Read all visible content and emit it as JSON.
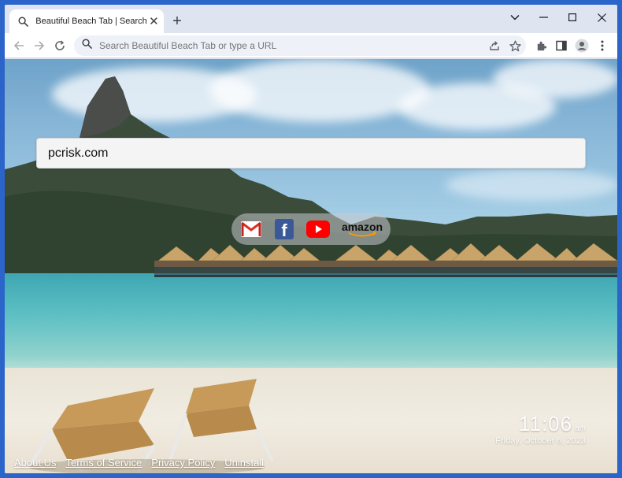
{
  "browser": {
    "tab_title": "Beautiful Beach Tab | Search",
    "new_tab_label": "+",
    "omnibox_placeholder": "Search Beautiful Beach Tab or type a URL"
  },
  "page": {
    "search_value": "pcrisk.com",
    "quicklinks": [
      {
        "name": "gmail",
        "label": "M",
        "color": "#d93025"
      },
      {
        "name": "facebook",
        "label": "f",
        "color": "#1877f2"
      },
      {
        "name": "youtube",
        "label": "▶",
        "color": "#ff0000"
      },
      {
        "name": "amazon",
        "label": "amazon",
        "color": "#111111"
      }
    ],
    "clock": {
      "time": "11:06",
      "ampm": "am",
      "date": "Friday, October 6, 2023"
    },
    "footer_links": [
      "About Us",
      "Terms of Service",
      "Privacy Policy",
      "Uninstall"
    ]
  },
  "icons": {
    "tab": "search-icon",
    "back": "arrow-left-icon",
    "forward": "arrow-right-icon",
    "reload": "reload-icon",
    "share": "share-icon",
    "bookmark": "star-icon",
    "extensions": "puzzle-icon",
    "sidepanel": "side-panel-icon",
    "profile": "profile-icon",
    "menu": "kebab-menu-icon"
  }
}
